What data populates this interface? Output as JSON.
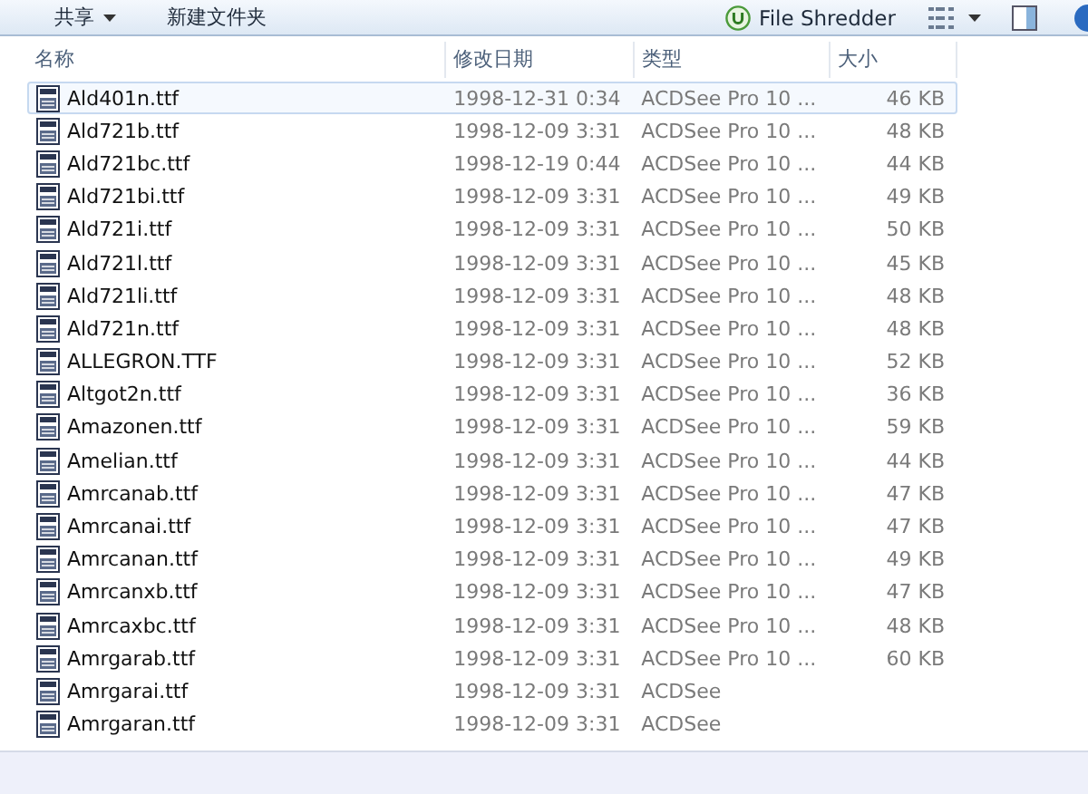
{
  "toolbar": {
    "buttons": [
      {
        "label": "共享",
        "dropdown": true
      },
      {
        "label": "新建文件夹",
        "dropdown": false
      }
    ],
    "shredder": {
      "label": "File Shredder"
    }
  },
  "table": {
    "columns": [
      "名称",
      "修改日期",
      "类型",
      "大小"
    ],
    "rows": [
      {
        "name": "Ald401n.ttf",
        "date": "1998-12-31 0:34",
        "type": "ACDSee Pro 10 ...",
        "size": "46 KB",
        "selected": true
      },
      {
        "name": "Ald721b.ttf",
        "date": "1998-12-09 3:31",
        "type": "ACDSee Pro 10 ...",
        "size": "48 KB",
        "selected": false
      },
      {
        "name": "Ald721bc.ttf",
        "date": "1998-12-19 0:44",
        "type": "ACDSee Pro 10 ...",
        "size": "44 KB",
        "selected": false
      },
      {
        "name": "Ald721bi.ttf",
        "date": "1998-12-09 3:31",
        "type": "ACDSee Pro 10 ...",
        "size": "49 KB",
        "selected": false
      },
      {
        "name": "Ald721i.ttf",
        "date": "1998-12-09 3:31",
        "type": "ACDSee Pro 10 ...",
        "size": "50 KB",
        "selected": false
      },
      {
        "name": "Ald721l.ttf",
        "date": "1998-12-09 3:31",
        "type": "ACDSee Pro 10 ...",
        "size": "45 KB",
        "selected": false
      },
      {
        "name": "Ald721li.ttf",
        "date": "1998-12-09 3:31",
        "type": "ACDSee Pro 10 ...",
        "size": "48 KB",
        "selected": false
      },
      {
        "name": "Ald721n.ttf",
        "date": "1998-12-09 3:31",
        "type": "ACDSee Pro 10 ...",
        "size": "48 KB",
        "selected": false
      },
      {
        "name": "ALLEGRON.TTF",
        "date": "1998-12-09 3:31",
        "type": "ACDSee Pro 10 ...",
        "size": "52 KB",
        "selected": false
      },
      {
        "name": "Altgot2n.ttf",
        "date": "1998-12-09 3:31",
        "type": "ACDSee Pro 10 ...",
        "size": "36 KB",
        "selected": false
      },
      {
        "name": "Amazonen.ttf",
        "date": "1998-12-09 3:31",
        "type": "ACDSee Pro 10 ...",
        "size": "59 KB",
        "selected": false
      },
      {
        "name": "Amelian.ttf",
        "date": "1998-12-09 3:31",
        "type": "ACDSee Pro 10 ...",
        "size": "44 KB",
        "selected": false
      },
      {
        "name": "Amrcanab.ttf",
        "date": "1998-12-09 3:31",
        "type": "ACDSee Pro 10 ...",
        "size": "47 KB",
        "selected": false
      },
      {
        "name": "Amrcanai.ttf",
        "date": "1998-12-09 3:31",
        "type": "ACDSee Pro 10 ...",
        "size": "47 KB",
        "selected": false
      },
      {
        "name": "Amrcanan.ttf",
        "date": "1998-12-09 3:31",
        "type": "ACDSee Pro 10 ...",
        "size": "49 KB",
        "selected": false
      },
      {
        "name": "Amrcanxb.ttf",
        "date": "1998-12-09 3:31",
        "type": "ACDSee Pro 10 ...",
        "size": "47 KB",
        "selected": false
      },
      {
        "name": "Amrcaxbc.ttf",
        "date": "1998-12-09 3:31",
        "type": "ACDSee Pro 10 ...",
        "size": "48 KB",
        "selected": false
      },
      {
        "name": "Amrgarab.ttf",
        "date": "1998-12-09 3:31",
        "type": "ACDSee Pro 10 ...",
        "size": "60 KB",
        "selected": false
      },
      {
        "name": "Amrgarai.ttf",
        "date": "1998-12-09 3:31",
        "type": "ACDSee",
        "selected": false
      },
      {
        "name": "Amrgaran.ttf",
        "date": "1998-12-09 3:31",
        "type": "ACDSee",
        "selected": false
      }
    ]
  }
}
